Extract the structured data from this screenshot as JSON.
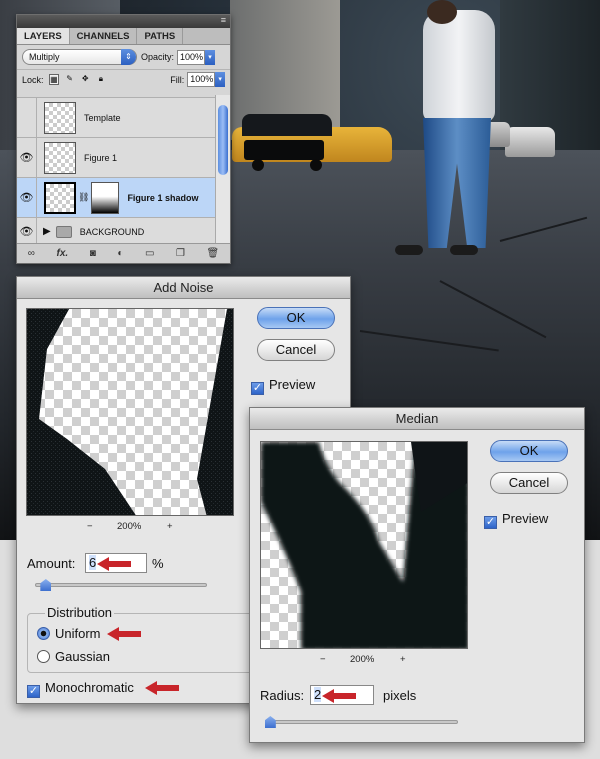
{
  "layers_panel": {
    "tabs": [
      "LAYERS",
      "CHANNELS",
      "PATHS"
    ],
    "blend_mode": "Multiply",
    "opacity_label": "Opacity:",
    "opacity_value": "100%",
    "lock_label": "Lock:",
    "fill_label": "Fill:",
    "fill_value": "100%",
    "layers": [
      {
        "name": "Template",
        "visible": false
      },
      {
        "name": "Figure 1",
        "visible": true
      },
      {
        "name": "Figure 1 shadow",
        "visible": true,
        "selected": true
      },
      {
        "name": "BACKGROUND",
        "visible": true,
        "group": true
      }
    ],
    "bottom_icons": [
      "link-icon",
      "fx-icon",
      "mask-icon",
      "adjustment-icon",
      "folder-icon",
      "new-layer-icon",
      "trash-icon"
    ],
    "fx_label": "fx."
  },
  "add_noise": {
    "title": "Add Noise",
    "ok": "OK",
    "cancel": "Cancel",
    "preview_label": "Preview",
    "zoom_minus": "−",
    "zoom_value": "200%",
    "zoom_plus": "+",
    "amount_label": "Amount:",
    "amount_value": "6",
    "amount_unit": "%",
    "amount_slider_fraction": 0.06,
    "distribution_label": "Distribution",
    "uniform_label": "Uniform",
    "gaussian_label": "Gaussian",
    "selected_distribution": "Uniform",
    "monochromatic_label": "Monochromatic"
  },
  "median": {
    "title": "Median",
    "ok": "OK",
    "cancel": "Cancel",
    "preview_label": "Preview",
    "zoom_minus": "−",
    "zoom_value": "200%",
    "zoom_plus": "+",
    "radius_label": "Radius:",
    "radius_value": "2",
    "radius_unit": "pixels",
    "radius_slider_fraction": 0.02
  },
  "colors": {
    "highlight_arrow": "#c8252a",
    "selection_blue": "#bcd6f7",
    "default_button": "#6ea2ea"
  }
}
